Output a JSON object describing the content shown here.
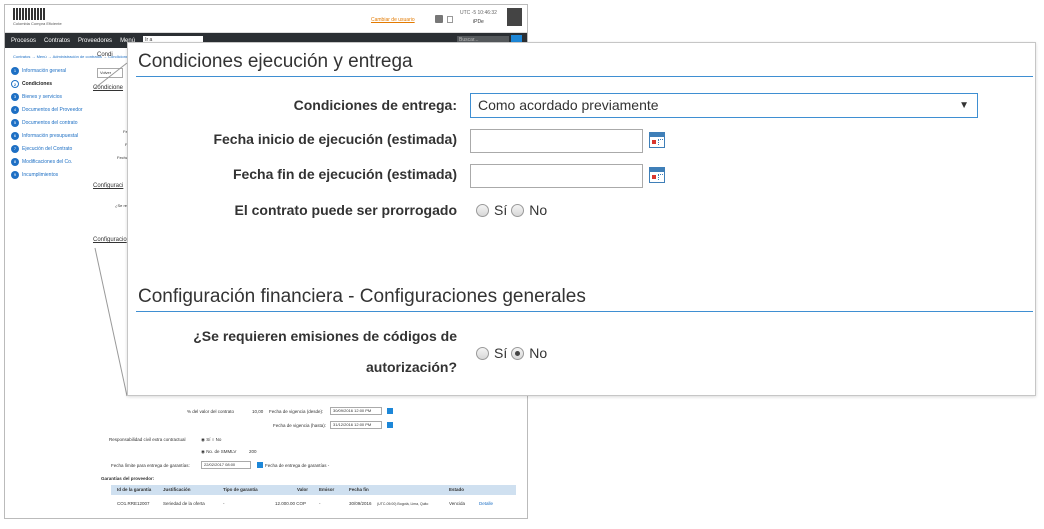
{
  "background": {
    "logo_text": "Colombia Compra Eficiente",
    "unit_link": "Cambiar de usuario",
    "utc_text": "UTC -5 10:46:32",
    "user_text": "iPDe",
    "nav": [
      "Procesos",
      "Contratos",
      "Proveedores",
      "Menú"
    ],
    "go_to": "Ir a",
    "search_placeholder": "Buscar...",
    "breadcrumb": "Contratos → Menú → Administración de contratos → Condiciones",
    "page_title": "Condi",
    "back_button": "Volver",
    "steps": [
      {
        "num": "1",
        "label": "Información general"
      },
      {
        "num": "2",
        "label": "Condiciones"
      },
      {
        "num": "3",
        "label": "Bienes y servicios"
      },
      {
        "num": "4",
        "label": "Documentos del Proveedor"
      },
      {
        "num": "5",
        "label": "Documentos del contrato"
      },
      {
        "num": "6",
        "label": "Información presupuestal"
      },
      {
        "num": "7",
        "label": "Ejecución del Contrato"
      },
      {
        "num": "8",
        "label": "Modificaciones del Co."
      },
      {
        "num": "9",
        "label": "Incumplimientos"
      }
    ],
    "sec_condiciones": "Condicione",
    "lbl_fe": "Fe",
    "lbl_f": "F",
    "lbl_fecha": "Fecha",
    "sec_config": "Configuraci",
    "lbl_se_req": "¿Se requ",
    "sec_config2": "Configuracio",
    "lower": {
      "pct_label": "% del valor del contrato",
      "pct_value": "10,00",
      "vig_desde_label": "Fecha de vigencia (desde):",
      "vig_desde_value": "30/09/2016 12:00 PM",
      "vig_hasta_label": "Fecha de vigencia (hasta):",
      "vig_hasta_value": "31/12/2016 12:00 PM",
      "resp_label": "Responsabilidad civil extra contractual",
      "opt_si": "Sí",
      "opt_no": "No",
      "smmlv_label": "No. de SMMLV",
      "smmlv_value": "200",
      "limite_label": "Fecha límite para entrega de garantías:",
      "limite_value": "22/02/2017 08:00",
      "entrega_label": "Fecha de entrega de garantías -",
      "garantias_title": "Garantías del proveedor:",
      "cols": [
        "Id de la garantía",
        "Justificación",
        "Tipo de garantía",
        "Valor",
        "Emisor",
        "Fecha fin",
        "Estado"
      ],
      "row": [
        "CO1.RRE12007",
        "Seriedad de la oferta",
        "-",
        "12.000.00 COP",
        "-",
        "30/09/2016",
        "Vencida",
        "Detalle"
      ],
      "row_tz": "(UTC-05:00) Bogotá, Lima, Quito"
    }
  },
  "zoom": {
    "section1_title": "Condiciones ejecución y entrega",
    "entrega_label": "Condiciones de entrega:",
    "entrega_value": "Como acordado previamente",
    "inicio_label": "Fecha inicio de ejecución (estimada)",
    "fin_label": "Fecha fin de ejecución (estimada)",
    "prorrogado_label": "El contrato puede ser prorrogado",
    "opt_si": "Sí",
    "opt_no": "No",
    "section2_title": "Configuración financiera - Configuraciones generales",
    "emisiones_label_line1": "¿Se requieren emisiones de códigos de",
    "emisiones_label_line2": "autorización?",
    "prorrogado_selected": "none",
    "emisiones_selected": "No"
  }
}
